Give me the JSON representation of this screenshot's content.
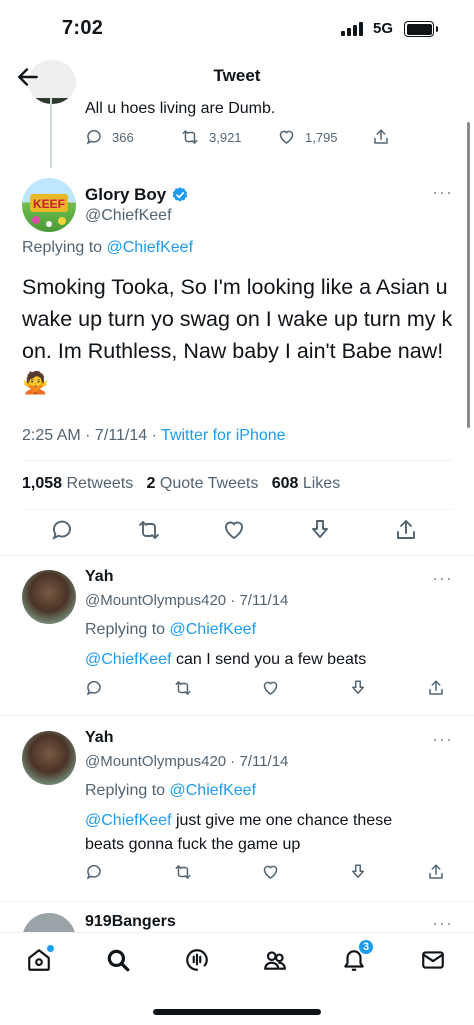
{
  "status_bar": {
    "time": "7:02",
    "network": "5G"
  },
  "nav": {
    "title": "Tweet"
  },
  "parent_tweet": {
    "text": "All u hoes living are Dumb.",
    "replies": "366",
    "retweets": "3,921",
    "likes": "1,795"
  },
  "main_tweet": {
    "author_name": "Glory Boy",
    "handle": "@ChiefKeef",
    "avatar_text": "KEEF",
    "replying_label": "Replying to",
    "replying_to": "@ChiefKeef",
    "text": "Smoking Tooka, So I'm looking like a Asian u wake up turn yo swag on I wake up turn my k on. Im Ruthless, Naw baby I ain't Babe naw!🙅",
    "time": "2:25 AM · 7/11/14 · ",
    "source": "Twitter for iPhone",
    "retweets_count": "1,058",
    "retweets_label": "Retweets",
    "quotes_count": "2",
    "quotes_label": "Quote Tweets",
    "likes_count": "608",
    "likes_label": "Likes"
  },
  "replies": [
    {
      "name": "Yah",
      "handle_date": "@MountOlympus420 · 7/11/14",
      "replying_label": "Replying to",
      "replying_to": "@ChiefKeef",
      "mention": "@ChiefKeef",
      "text": " can I send you a few beats"
    },
    {
      "name": "Yah",
      "handle_date": "@MountOlympus420 · 7/11/14",
      "replying_label": "Replying to",
      "replying_to": "@ChiefKeef",
      "mention": "@ChiefKeef",
      "text": " just give me one chance these beats gonna fuck the game up"
    },
    {
      "name": "919Bangers"
    }
  ],
  "more_glyph": "···",
  "tab_bar": {
    "items": [
      "home-icon",
      "search-icon",
      "spaces-icon",
      "communities-icon",
      "notifications-icon",
      "messages-icon"
    ],
    "notification_badge": "3"
  },
  "colors": {
    "accent": "#1d9bf0",
    "text": "#0f1419",
    "secondary": "#536471"
  }
}
